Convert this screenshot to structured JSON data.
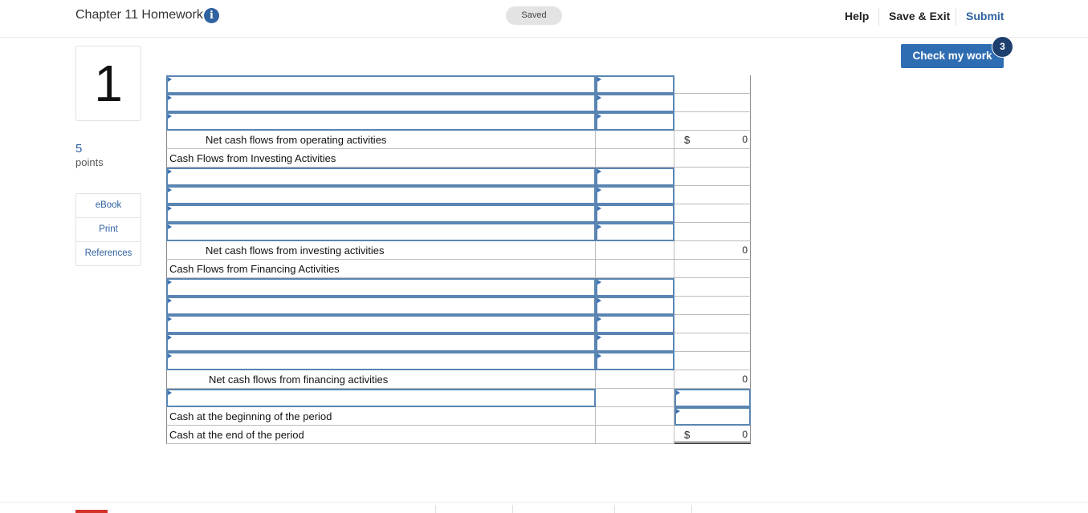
{
  "header": {
    "title": "Chapter 11 Homework",
    "info_glyph": "i",
    "status": "Saved",
    "help": "Help",
    "save_exit": "Save & Exit",
    "submit": "Submit"
  },
  "question": {
    "number": "1",
    "points_value": "5",
    "points_label": "points",
    "tools": [
      "eBook",
      "Print",
      "References"
    ]
  },
  "check": {
    "label": "Check my work",
    "badge": "3"
  },
  "worksheet": {
    "rows": [
      {
        "type": "input"
      },
      {
        "type": "input"
      },
      {
        "type": "input"
      },
      {
        "type": "total",
        "label": "Net cash flows from operating activities",
        "dollar": "$",
        "value": "0"
      },
      {
        "type": "header",
        "label": "Cash Flows from Investing Activities"
      },
      {
        "type": "input"
      },
      {
        "type": "input"
      },
      {
        "type": "input"
      },
      {
        "type": "input"
      },
      {
        "type": "total",
        "label": "Net cash flows from investing activities",
        "dollar": "",
        "value": "0"
      },
      {
        "type": "header",
        "label": "Cash Flows from Financing Activities"
      },
      {
        "type": "input"
      },
      {
        "type": "input"
      },
      {
        "type": "input"
      },
      {
        "type": "input"
      },
      {
        "type": "input"
      },
      {
        "type": "total",
        "label": "Net cash flows from financing activities",
        "dollar": "",
        "value": "0"
      },
      {
        "type": "input-wide"
      },
      {
        "type": "cash-begin",
        "label": "Cash at the beginning of the period"
      },
      {
        "type": "cash-end",
        "label": "Cash at the end of the period",
        "dollar": "$",
        "value": "0"
      }
    ]
  }
}
